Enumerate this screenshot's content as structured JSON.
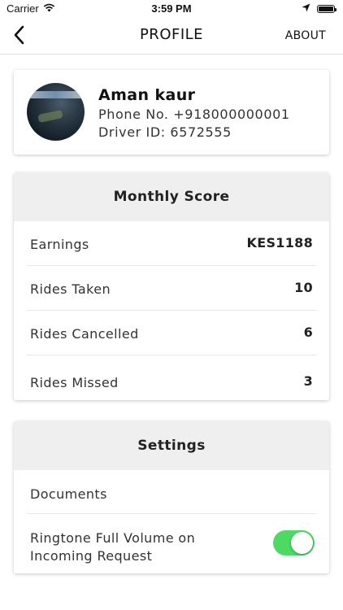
{
  "status_bar": {
    "carrier": "Carrier",
    "time": "3:59 PM",
    "icons": [
      "wifi-icon",
      "location-arrow-icon",
      "battery-icon"
    ]
  },
  "nav": {
    "back_icon": "chevron-left-icon",
    "title": "PROFILE",
    "about_label": "ABOUT"
  },
  "profile": {
    "name": "Aman kaur",
    "phone": "Phone No. +918000000001",
    "driver_id": "Driver ID: 6572555"
  },
  "monthly_score": {
    "title": "Monthly Score",
    "rows": [
      {
        "label": "Earnings",
        "value": "KES1188"
      },
      {
        "label": "Rides Taken",
        "value": "10"
      },
      {
        "label": "Rides Cancelled",
        "value": "6"
      },
      {
        "label": "Rides Missed",
        "value": "3"
      }
    ]
  },
  "settings": {
    "title": "Settings",
    "documents_label": "Documents",
    "ringtone_label": "Ringtone Full Volume on Incoming Request",
    "ringtone_enabled": true,
    "toggle_color": "#4cd964"
  }
}
